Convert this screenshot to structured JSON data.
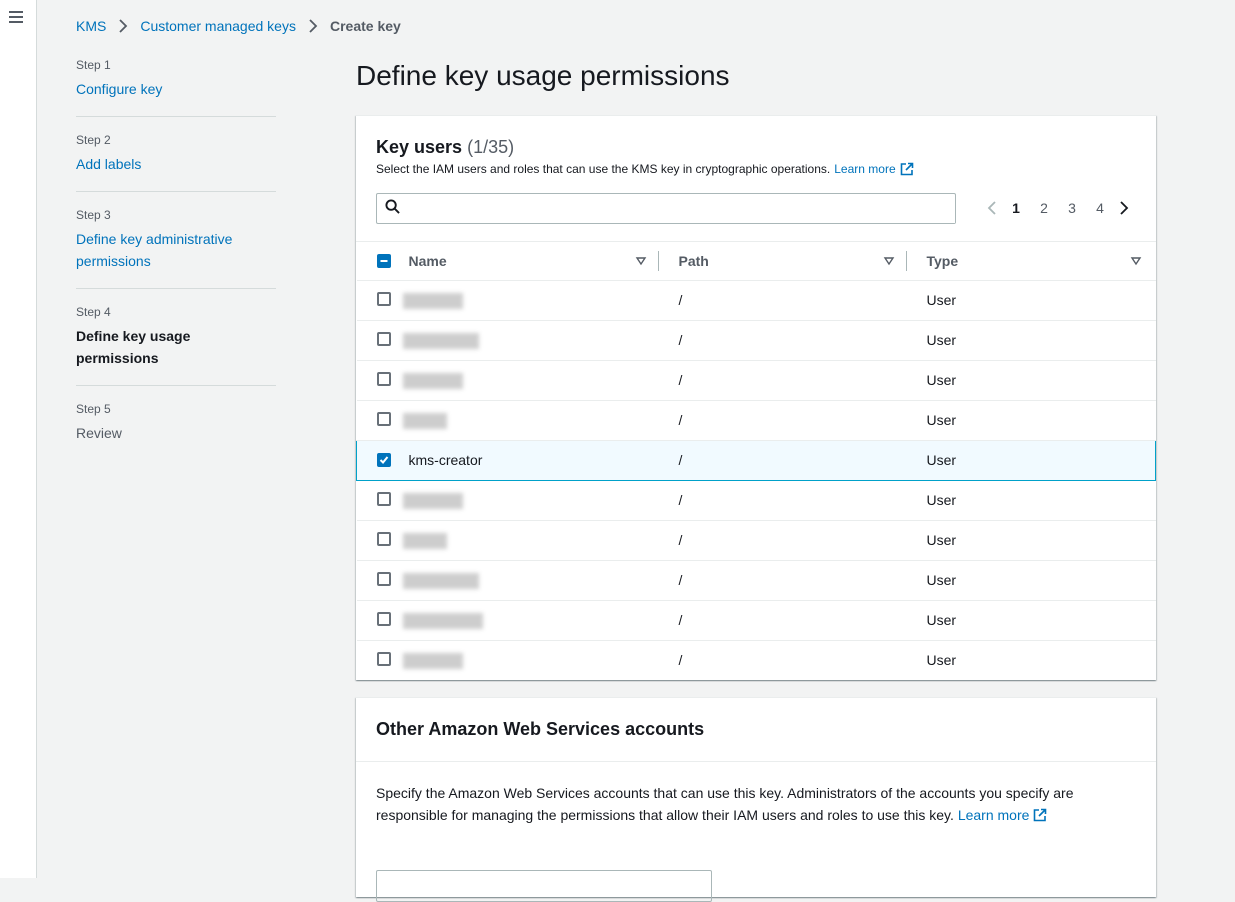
{
  "breadcrumb": [
    "KMS",
    "Customer managed keys",
    "Create key"
  ],
  "steps": [
    {
      "num": "Step 1",
      "label": "Configure key",
      "state": "link"
    },
    {
      "num": "Step 2",
      "label": "Add labels",
      "state": "link"
    },
    {
      "num": "Step 3",
      "label": "Define key administrative permissions",
      "state": "link"
    },
    {
      "num": "Step 4",
      "label": "Define key usage permissions",
      "state": "active"
    },
    {
      "num": "Step 5",
      "label": "Review",
      "state": "disabled"
    }
  ],
  "page_title": "Define key usage permissions",
  "key_users": {
    "title": "Key users",
    "count": "(1/35)",
    "description": "Select the IAM users and roles that can use the KMS key in cryptographic operations.",
    "learn_more": "Learn more",
    "search_placeholder": "",
    "pagination": {
      "pages": [
        "1",
        "2",
        "3",
        "4"
      ],
      "current": "1"
    },
    "columns": [
      "Name",
      "Path",
      "Type"
    ],
    "rows": [
      {
        "name": "",
        "redacted": true,
        "path": "/",
        "type": "User",
        "checked": false
      },
      {
        "name": "",
        "redacted": true,
        "path": "/",
        "type": "User",
        "checked": false
      },
      {
        "name": "",
        "redacted": true,
        "path": "/",
        "type": "User",
        "checked": false
      },
      {
        "name": "",
        "redacted": true,
        "path": "/",
        "type": "User",
        "checked": false
      },
      {
        "name": "kms-creator",
        "redacted": false,
        "path": "/",
        "type": "User",
        "checked": true
      },
      {
        "name": "",
        "redacted": true,
        "path": "/",
        "type": "User",
        "checked": false
      },
      {
        "name": "",
        "redacted": true,
        "path": "/",
        "type": "User",
        "checked": false
      },
      {
        "name": "",
        "redacted": true,
        "path": "/",
        "type": "User",
        "checked": false
      },
      {
        "name": "",
        "redacted": true,
        "path": "/",
        "type": "User",
        "checked": false
      },
      {
        "name": "",
        "redacted": true,
        "path": "/",
        "type": "User",
        "checked": false
      }
    ]
  },
  "other_accounts": {
    "title": "Other Amazon Web Services accounts",
    "description": "Specify the Amazon Web Services accounts that can use this key. Administrators of the accounts you specify are responsible for managing the permissions that allow their IAM users and roles to use this key.",
    "learn_more": "Learn more"
  },
  "colors": {
    "link": "#0073bb",
    "selected_border": "#00a1c9",
    "selected_bg": "#f1faff",
    "checkbox": "#0073bb"
  }
}
